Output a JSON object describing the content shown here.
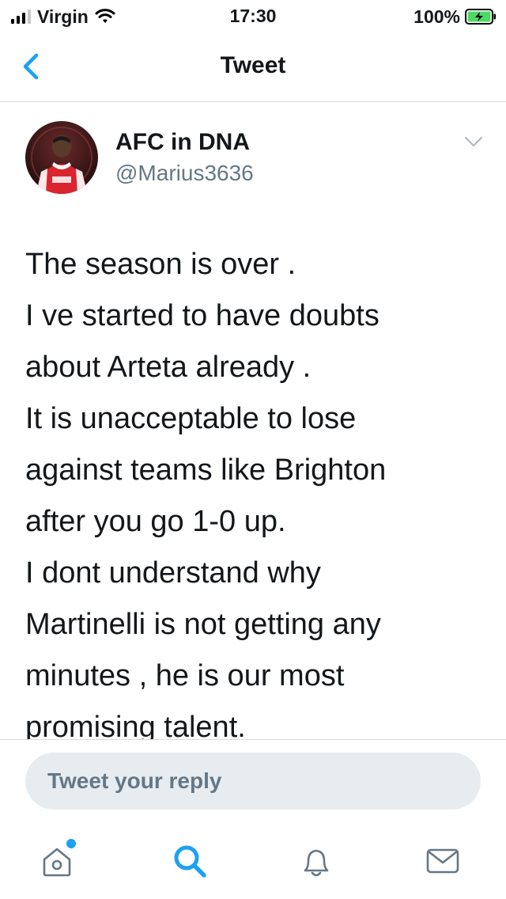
{
  "status_bar": {
    "carrier": "Virgin",
    "time": "17:30",
    "battery": "100%"
  },
  "nav": {
    "title": "Tweet"
  },
  "tweet": {
    "author_name": "AFC in DNA",
    "author_handle": "@Marius3636",
    "lines": [
      "The season is over .",
      "I ve started to have doubts",
      "about Arteta already .",
      "It is unacceptable to lose",
      "against teams like Brighton",
      "after you go 1-0 up.",
      "I dont understand why",
      "Martinelli is not getting any",
      "minutes , he is our most",
      "promising talent."
    ]
  },
  "reply": {
    "placeholder": "Tweet your reply"
  },
  "tabs": [
    {
      "name": "home",
      "icon": "home-icon",
      "has_badge": true
    },
    {
      "name": "search",
      "icon": "search-icon",
      "active": true
    },
    {
      "name": "notifications",
      "icon": "bell-icon"
    },
    {
      "name": "messages",
      "icon": "mail-icon"
    }
  ],
  "colors": {
    "accent": "#1da1f2",
    "text": "#14171a",
    "secondary": "#657786",
    "reply_bg": "#e6ecf0",
    "battery_green": "#4cd964"
  }
}
